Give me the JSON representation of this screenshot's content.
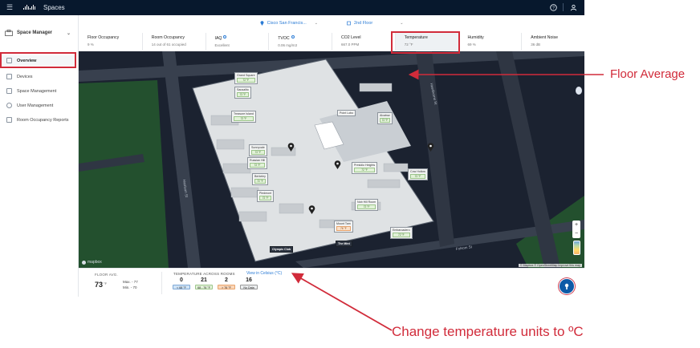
{
  "topbar": {
    "title": "Spaces",
    "icons": [
      "menu-icon",
      "cisco-logo",
      "help-icon",
      "user-icon"
    ]
  },
  "sidebar": {
    "workspace": "Space Manager",
    "items": [
      {
        "label": "Overview",
        "icon": "home-icon",
        "active": true
      },
      {
        "label": "Devices",
        "icon": "device-icon"
      },
      {
        "label": "Space Management",
        "icon": "building-icon"
      },
      {
        "label": "User Management",
        "icon": "user-icon"
      },
      {
        "label": "Room Occupancy Reports",
        "icon": "report-icon"
      }
    ]
  },
  "location": {
    "site": "Cisco San Francis...",
    "floor": "2nd Floor"
  },
  "metrics": [
    {
      "title": "Floor Occupancy",
      "value": "9 %"
    },
    {
      "title": "Room Occupancy",
      "value": "14 out of 61 occupied"
    },
    {
      "title": "IAQ",
      "value": "Excellent"
    },
    {
      "title": "TVOC",
      "value": "0.06 mg/m3"
    },
    {
      "title": "CO2 Level",
      "value": "667.0 PPM"
    },
    {
      "title": "Temperature",
      "value": "72 °F"
    },
    {
      "title": "Humidity",
      "value": "69 %"
    },
    {
      "title": "Ambient Noise",
      "value": "36 dB"
    }
  ],
  "map": {
    "attribution": "mapbox",
    "copyright": "© Mapbox © OpenStreetMap Improve this map",
    "street_labels": [
      "Harrison St",
      "Hawthorne St",
      "Folsom St"
    ],
    "rooms": [
      {
        "name": "Grand Square",
        "temp": "72 °F"
      },
      {
        "name": "Treasure Island",
        "temp": "72 °F"
      },
      {
        "name": "Sausalito",
        "temp": "72 °F"
      },
      {
        "name": "Sunnyvale",
        "temp": "72 °F"
      },
      {
        "name": "Russian Hill",
        "temp": "72 °F"
      },
      {
        "name": "Berkeley",
        "temp": "72 °F"
      },
      {
        "name": "Piedmont",
        "temp": "72 °F"
      },
      {
        "name": "Point Lobo",
        "temp": ""
      },
      {
        "name": "Alcatraz",
        "temp": "72 °F"
      },
      {
        "name": "Presidio Heights",
        "temp": "72 °F"
      },
      {
        "name": "Cow Hollow",
        "temp": "72 °F"
      },
      {
        "name": "Nob Hill Room",
        "temp": "72 °F"
      },
      {
        "name": "Mount Tam",
        "temp": "76 °F"
      },
      {
        "name": "Embarcadero",
        "temp": "72 °F"
      },
      {
        "name": "Olympic Club",
        "temp": ""
      },
      {
        "name": "The Mint",
        "temp": ""
      }
    ]
  },
  "floor_avg": {
    "label": "FLOOR AVG.",
    "value": "73",
    "unit": "°F",
    "max": "Max. - 77",
    "min": "Min. - 70"
  },
  "temp_rooms": {
    "label": "TEMPERATURE ACROSS ROOMS",
    "view_link": "View in Celsius (°C)",
    "bins": [
      {
        "count": "0",
        "range": "< 68 °F"
      },
      {
        "count": "21",
        "range": "68 - 76 °F"
      },
      {
        "count": "2",
        "range": "> 76 °F"
      },
      {
        "count": "16",
        "range": "No Data"
      }
    ]
  },
  "annotations": {
    "floor_average": "Floor Average",
    "change_units": "Change temperature units to ºC"
  },
  "colors": {
    "annotation": "#d12b3a",
    "topbar": "#07182d",
    "link": "#2a7bd5",
    "map_bg": "#1b2230",
    "park": "#23502e"
  }
}
